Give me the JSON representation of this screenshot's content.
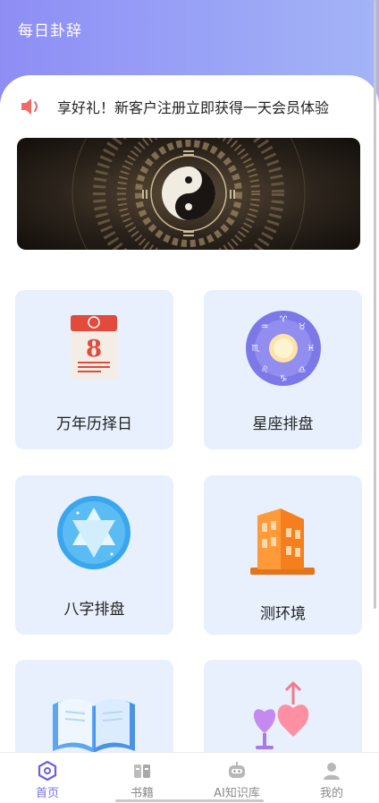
{
  "app": {
    "title": "每日卦辞"
  },
  "notice": {
    "text": "享好礼！新客户注册立即获得一天会员体验"
  },
  "cards": [
    {
      "label": "万年历择日",
      "icon": "calendar-icon"
    },
    {
      "label": "星座排盘",
      "icon": "zodiac-wheel-icon"
    },
    {
      "label": "八字排盘",
      "icon": "hexagram-star-icon"
    },
    {
      "label": "测环境",
      "icon": "building-icon"
    },
    {
      "label": "",
      "icon": "open-book-icon"
    },
    {
      "label": "",
      "icon": "hearts-icon"
    }
  ],
  "tabbar": {
    "tabs": [
      {
        "label": "首页",
        "icon": "home-icon",
        "active": true
      },
      {
        "label": "书籍",
        "icon": "books-icon",
        "active": false
      },
      {
        "label": "AI知识库",
        "icon": "robot-icon",
        "active": false
      },
      {
        "label": "我的",
        "icon": "user-icon",
        "active": false
      }
    ]
  },
  "colors": {
    "header_start": "#8e8df5",
    "header_end": "#a4b4f7",
    "card_bg": "#e7f0fc",
    "accent": "#7a70e8",
    "speaker": "#f06a6a"
  }
}
